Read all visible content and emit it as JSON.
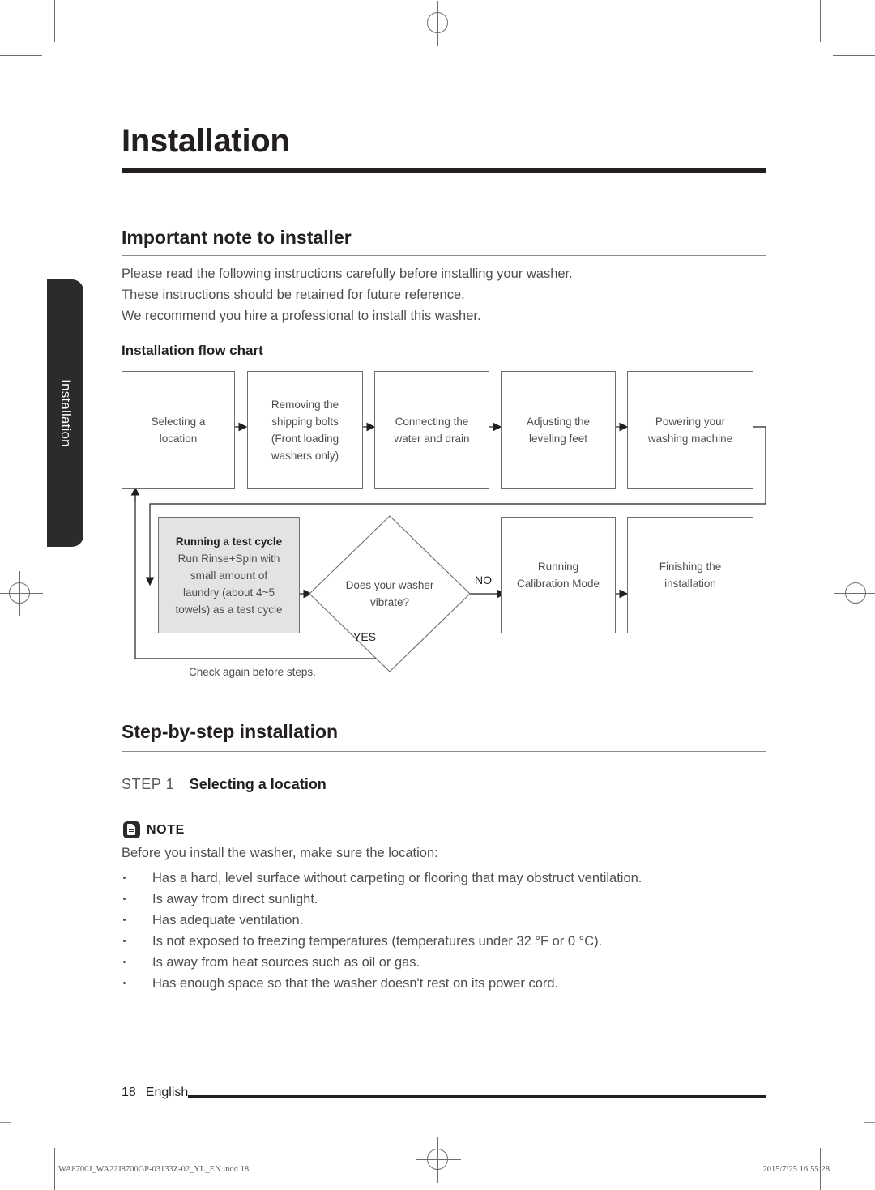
{
  "page": {
    "title": "Installation",
    "side_tab_label": "Installation",
    "folio_number": "18",
    "folio_language": "English"
  },
  "important_note": {
    "heading": "Important note to installer",
    "lines": [
      "Please read the following instructions carefully before installing your washer.",
      "These instructions should be retained for future reference.",
      "We recommend you hire a professional to install this washer."
    ]
  },
  "flow_chart": {
    "heading": "Installation flow chart",
    "row1": [
      "Selecting a\nlocation",
      "Removing the\nshipping bolts\n(Front loading\nwashers only)",
      "Connecting the\nwater and drain",
      "Adjusting the\nleveling feet",
      "Powering your\nwashing machine"
    ],
    "test_cycle": {
      "title": "Running a test cycle",
      "body": "Run Rinse+Spin with\nsmall amount of\nlaundry (about 4~5\ntowels) as a test cycle"
    },
    "decision": "Does your washer\nvibrate?",
    "branch_no": "NO",
    "branch_yes": "YES",
    "row2": [
      "Running\nCalibration Mode",
      "Finishing the\ninstallation"
    ],
    "caption": "Check again before steps."
  },
  "step_section": {
    "heading": "Step-by-step installation",
    "step_label": "STEP 1",
    "step_name": "Selecting a location"
  },
  "note": {
    "icon": "note-document-icon",
    "title": "NOTE",
    "intro": "Before you install the washer, make sure the location:",
    "bullets": [
      "Has a hard, level surface without carpeting or flooring that may obstruct ventilation.",
      "Is away from direct sunlight.",
      "Has adequate ventilation.",
      "Is not exposed to freezing temperatures (temperatures under 32 °F or 0 °C).",
      "Is away from heat sources such as oil or gas.",
      "Has enough space so that the washer doesn't rest on its power cord."
    ]
  },
  "imprint": {
    "file": "WA8700J_WA22J8700GP-03133Z-02_YL_EN.indd   18",
    "timestamp": "2015/7/25   16:55:28"
  },
  "colors": {
    "ink": "#231f20",
    "body_text": "#4d4d4f",
    "rule": "#8c8c8c",
    "tab_bg": "#2b2b2d",
    "shaded_box": "#e3e3e3"
  }
}
